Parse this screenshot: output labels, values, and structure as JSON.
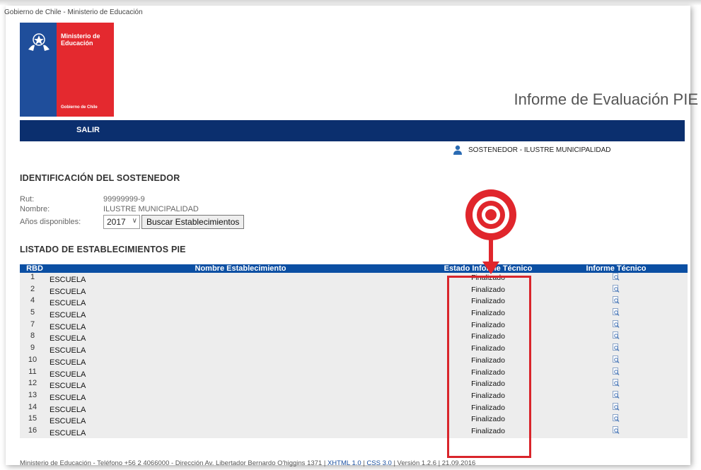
{
  "header": {
    "gov_text": "Gobierno de Chile - Ministerio de Educación",
    "logo_title": "Ministerio de Educación",
    "logo_subtitle": "Gobierno de Chile",
    "app_title": "Informe de Evaluación PIE"
  },
  "nav": {
    "salir": "SALIR"
  },
  "user": {
    "label": "SOSTENEDOR - ILUSTRE MUNICIPALIDAD"
  },
  "ident": {
    "title": "IDENTIFICACIÓN DEL SOSTENEDOR",
    "rut_label": "Rut:",
    "rut_value": "99999999-9",
    "nombre_label": "Nombre:",
    "nombre_value": "ILUSTRE MUNICIPALIDAD",
    "years_label": "Años disponibles:",
    "year_selected": "2017",
    "search_button": "Buscar Establecimientos"
  },
  "list": {
    "title": "LISTADO DE ESTABLECIMIENTOS PIE",
    "columns": [
      "RBD",
      "Nombre Establecimiento",
      "Estado Informe Técnico",
      "Informe Técnico"
    ],
    "rows": [
      {
        "rbd": "1",
        "nombre": "ESCUELA",
        "estado": "Finalizado"
      },
      {
        "rbd": "2",
        "nombre": "ESCUELA",
        "estado": "Finalizado"
      },
      {
        "rbd": "4",
        "nombre": "ESCUELA",
        "estado": "Finalizado"
      },
      {
        "rbd": "5",
        "nombre": "ESCUELA",
        "estado": "Finalizado"
      },
      {
        "rbd": "7",
        "nombre": "ESCUELA",
        "estado": "Finalizado"
      },
      {
        "rbd": "8",
        "nombre": "ESCUELA",
        "estado": "Finalizado"
      },
      {
        "rbd": "9",
        "nombre": "ESCUELA",
        "estado": "Finalizado"
      },
      {
        "rbd": "10",
        "nombre": "ESCUELA",
        "estado": "Finalizado"
      },
      {
        "rbd": "11",
        "nombre": "ESCUELA",
        "estado": "Finalizado"
      },
      {
        "rbd": "12",
        "nombre": "ESCUELA",
        "estado": "Finalizado"
      },
      {
        "rbd": "13",
        "nombre": "ESCUELA",
        "estado": "Finalizado"
      },
      {
        "rbd": "14",
        "nombre": "ESCUELA",
        "estado": "Finalizado"
      },
      {
        "rbd": "15",
        "nombre": "ESCUELA",
        "estado": "Finalizado"
      },
      {
        "rbd": "16",
        "nombre": "ESCUELA",
        "estado": "Finalizado"
      }
    ],
    "row_icon": "magnifier-document-icon"
  },
  "footer": {
    "text": "Ministerio de Educación - Teléfono +56 2 4066000 - Dirección Av. Libertador Bernardo O'higgins 1371 |",
    "xhtml": "XHTML 1.0",
    "css": "CSS 3.0",
    "version": "| Versión 1.2.6 | 21.09.2016",
    "sep": "|"
  },
  "colors": {
    "nav_bg": "#0b2f6e",
    "table_header_bg": "#0b4fa3",
    "row_bg": "#ededed",
    "highlight": "#d9252b",
    "logo_blue": "#1f4e9b",
    "logo_red": "#e4292f"
  }
}
